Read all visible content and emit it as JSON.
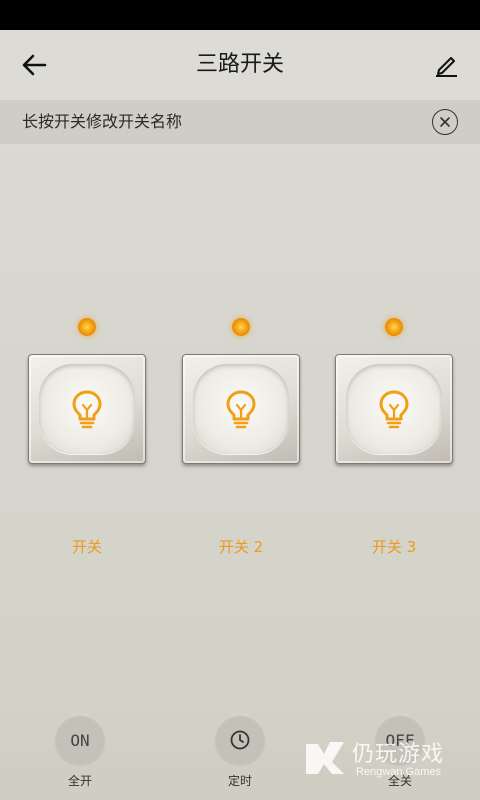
{
  "header": {
    "title": "三路开关",
    "back_icon": "arrow-left-icon",
    "edit_icon": "pencil-icon"
  },
  "hint": {
    "text": "长按开关修改开关名称",
    "close_icon": "close-circle-icon"
  },
  "switches": [
    {
      "label": "开关",
      "state": "on",
      "icon": "bulb-icon"
    },
    {
      "label": "开关 2",
      "state": "on",
      "icon": "bulb-icon"
    },
    {
      "label": "开关 3",
      "state": "on",
      "icon": "bulb-icon"
    }
  ],
  "bottom": {
    "all_on": {
      "button_text": "ON",
      "label": "全开"
    },
    "timer": {
      "icon": "clock-icon",
      "label": "定时"
    },
    "all_off": {
      "button_text": "OFF",
      "label": "全关"
    }
  },
  "watermark": {
    "text": "仍玩游戏",
    "sub": "Rengwan Games"
  },
  "colors": {
    "accent": "#ee9a1f",
    "led": "#f3a10d",
    "background": "#d7d6cf"
  }
}
